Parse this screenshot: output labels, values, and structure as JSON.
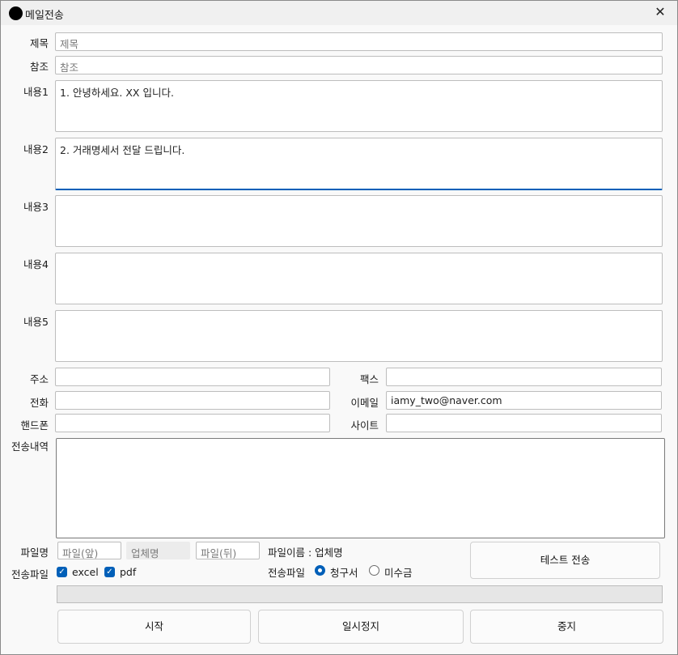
{
  "window": {
    "title": "메일전송",
    "close_label": "✕"
  },
  "fields": {
    "subject": {
      "label": "제목",
      "placeholder": "제목"
    },
    "cc": {
      "label": "참조",
      "placeholder": "참조"
    },
    "body1": {
      "label": "내용1",
      "value": "1. 안녕하세요. XX 입니다."
    },
    "body2": {
      "label": "내용2",
      "value": "2. 거래명세서 전달 드립니다."
    },
    "body3": {
      "label": "내용3",
      "value": ""
    },
    "body4": {
      "label": "내용4",
      "value": ""
    },
    "body5": {
      "label": "내용5",
      "value": ""
    },
    "address": {
      "label": "주소",
      "value": ""
    },
    "fax": {
      "label": "팩스",
      "value": ""
    },
    "phone": {
      "label": "전화",
      "value": ""
    },
    "email": {
      "label": "이메일",
      "value": "iamy_two@naver.com"
    },
    "mobile": {
      "label": "핸드폰",
      "value": ""
    },
    "site": {
      "label": "사이트",
      "value": ""
    },
    "history": {
      "label": "전송내역",
      "value": ""
    }
  },
  "file": {
    "label": "파일명",
    "front_placeholder": "파일(앞)",
    "company_placeholder": "업체명",
    "back_placeholder": "파일(뒤)",
    "name_preview": "파일이름 : 업체명"
  },
  "send_file": {
    "label": "전송파일",
    "excel_label": "excel",
    "excel_checked": true,
    "pdf_label": "pdf",
    "pdf_checked": true
  },
  "send_type": {
    "label": "전송파일",
    "options": [
      {
        "label": "청구서",
        "selected": true
      },
      {
        "label": "미수금",
        "selected": false
      }
    ]
  },
  "progress": {
    "value": 0
  },
  "buttons": {
    "test_send": "테스트 전송",
    "start": "시작",
    "pause": "일시정지",
    "stop": "중지"
  }
}
